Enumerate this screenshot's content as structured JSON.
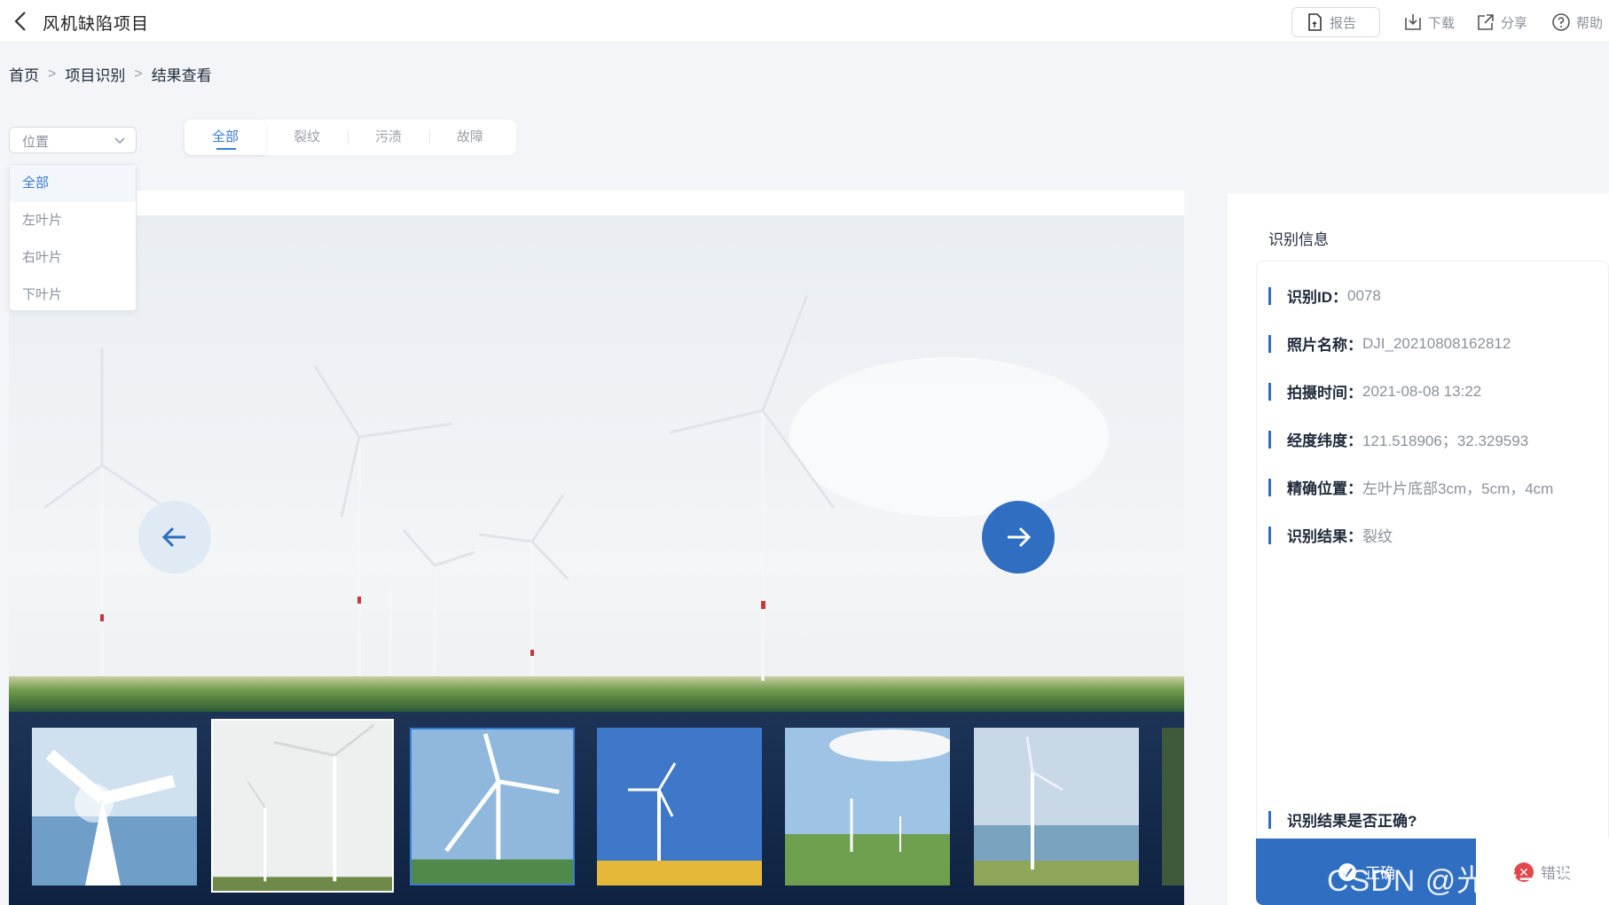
{
  "header": {
    "title": "风机缺陷项目",
    "report_label": "报告",
    "download_label": "下载",
    "share_label": "分享",
    "help_label": "帮助"
  },
  "breadcrumb": [
    "首页",
    "项目识别",
    "结果查看"
  ],
  "filter": {
    "select_placeholder": "位置",
    "options": [
      "全部",
      "左叶片",
      "右叶片",
      "下叶片"
    ],
    "selected_option": "全部"
  },
  "tabs": [
    {
      "label": "全部",
      "active": true
    },
    {
      "label": "裂纹",
      "active": false
    },
    {
      "label": "污渍",
      "active": false
    },
    {
      "label": "故障",
      "active": false
    }
  ],
  "panel": {
    "title": "识别信息",
    "fields": [
      {
        "key": "识别ID：",
        "value": "0078"
      },
      {
        "key": "照片名称：",
        "value": "DJI_20210808162812"
      },
      {
        "key": "拍摄时间：",
        "value": "2021-08-08  13:22"
      },
      {
        "key": "经度纬度：",
        "value": "121.518906；32.329593"
      },
      {
        "key": "精确位置：",
        "value": "左叶片底部3cm，5cm，4cm"
      },
      {
        "key": "识别结果：",
        "value": "裂纹"
      }
    ],
    "question": "识别结果是否正确?",
    "confirm_label": "正确",
    "wrong_label": "错误"
  },
  "watermark": "CSDN @光伏一点通",
  "colors": {
    "accent": "#2f6ec1",
    "danger": "#e2474b"
  }
}
